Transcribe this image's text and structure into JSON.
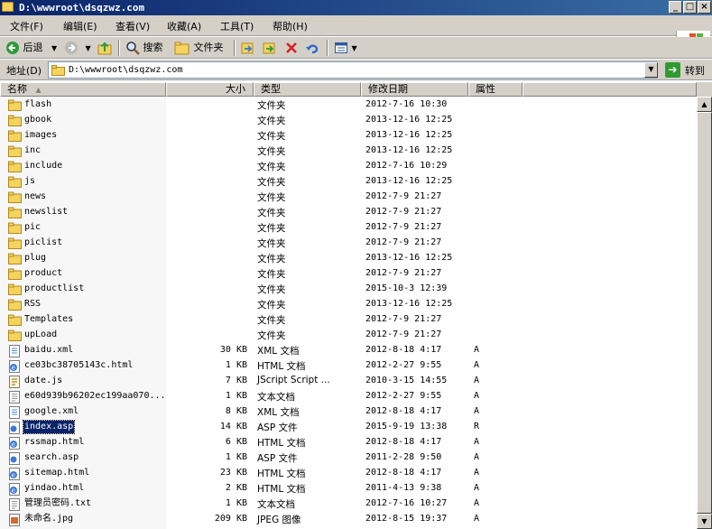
{
  "window": {
    "title": "D:\\wwwroot\\dsqzwz.com"
  },
  "menu": {
    "items": [
      "文件(F)",
      "编辑(E)",
      "查看(V)",
      "收藏(A)",
      "工具(T)",
      "帮助(H)"
    ]
  },
  "toolbar": {
    "back_label": "后退",
    "search_label": "搜索",
    "folders_label": "文件夹"
  },
  "address": {
    "label": "地址(D)",
    "value": "D:\\wwwroot\\dsqzwz.com",
    "go_label": "转到"
  },
  "columns": {
    "name": "名称",
    "size": "大小",
    "type": "类型",
    "modified": "修改日期",
    "attributes": "属性"
  },
  "files": [
    {
      "name": "flash",
      "size": "",
      "type": "文件夹",
      "modified": "2012-7-16 10:30",
      "attr": "",
      "icon": "folder-icon"
    },
    {
      "name": "gbook",
      "size": "",
      "type": "文件夹",
      "modified": "2013-12-16 12:25",
      "attr": "",
      "icon": "folder-icon"
    },
    {
      "name": "images",
      "size": "",
      "type": "文件夹",
      "modified": "2013-12-16 12:25",
      "attr": "",
      "icon": "folder-icon"
    },
    {
      "name": "inc",
      "size": "",
      "type": "文件夹",
      "modified": "2013-12-16 12:25",
      "attr": "",
      "icon": "folder-icon"
    },
    {
      "name": "include",
      "size": "",
      "type": "文件夹",
      "modified": "2012-7-16 10:29",
      "attr": "",
      "icon": "folder-icon"
    },
    {
      "name": "js",
      "size": "",
      "type": "文件夹",
      "modified": "2013-12-16 12:25",
      "attr": "",
      "icon": "folder-icon"
    },
    {
      "name": "news",
      "size": "",
      "type": "文件夹",
      "modified": "2012-7-9 21:27",
      "attr": "",
      "icon": "folder-icon"
    },
    {
      "name": "newslist",
      "size": "",
      "type": "文件夹",
      "modified": "2012-7-9 21:27",
      "attr": "",
      "icon": "folder-icon"
    },
    {
      "name": "pic",
      "size": "",
      "type": "文件夹",
      "modified": "2012-7-9 21:27",
      "attr": "",
      "icon": "folder-icon"
    },
    {
      "name": "piclist",
      "size": "",
      "type": "文件夹",
      "modified": "2012-7-9 21:27",
      "attr": "",
      "icon": "folder-icon"
    },
    {
      "name": "plug",
      "size": "",
      "type": "文件夹",
      "modified": "2013-12-16 12:25",
      "attr": "",
      "icon": "folder-icon"
    },
    {
      "name": "product",
      "size": "",
      "type": "文件夹",
      "modified": "2012-7-9 21:27",
      "attr": "",
      "icon": "folder-icon"
    },
    {
      "name": "productlist",
      "size": "",
      "type": "文件夹",
      "modified": "2015-10-3 12:39",
      "attr": "",
      "icon": "folder-icon"
    },
    {
      "name": "RSS",
      "size": "",
      "type": "文件夹",
      "modified": "2013-12-16 12:25",
      "attr": "",
      "icon": "folder-icon"
    },
    {
      "name": "Templates",
      "size": "",
      "type": "文件夹",
      "modified": "2012-7-9 21:27",
      "attr": "",
      "icon": "folder-icon"
    },
    {
      "name": "upLoad",
      "size": "",
      "type": "文件夹",
      "modified": "2012-7-9 21:27",
      "attr": "",
      "icon": "folder-icon"
    },
    {
      "name": "baidu.xml",
      "size": "30 KB",
      "type": "XML 文档",
      "modified": "2012-8-18 4:17",
      "attr": "A",
      "icon": "xml-file-icon"
    },
    {
      "name": "ce03bc38705143c.html",
      "size": "1 KB",
      "type": "HTML 文档",
      "modified": "2012-2-27 9:55",
      "attr": "A",
      "icon": "html-file-icon"
    },
    {
      "name": "date.js",
      "size": "7 KB",
      "type": "JScript Script ...",
      "modified": "2010-3-15 14:55",
      "attr": "A",
      "icon": "script-file-icon"
    },
    {
      "name": "e60d939b96202ec199aa070...",
      "size": "1 KB",
      "type": "文本文档",
      "modified": "2012-2-27 9:55",
      "attr": "A",
      "icon": "text-file-icon"
    },
    {
      "name": "google.xml",
      "size": "8 KB",
      "type": "XML 文档",
      "modified": "2012-8-18 4:17",
      "attr": "A",
      "icon": "xml-file-icon"
    },
    {
      "name": "index.asp",
      "size": "14 KB",
      "type": "ASP 文件",
      "modified": "2015-9-19 13:38",
      "attr": "R",
      "icon": "asp-file-icon",
      "selected": true
    },
    {
      "name": "rssmap.html",
      "size": "6 KB",
      "type": "HTML 文档",
      "modified": "2012-8-18 4:17",
      "attr": "A",
      "icon": "html-file-icon"
    },
    {
      "name": "search.asp",
      "size": "1 KB",
      "type": "ASP 文件",
      "modified": "2011-2-28 9:50",
      "attr": "A",
      "icon": "asp-file-icon"
    },
    {
      "name": "sitemap.html",
      "size": "23 KB",
      "type": "HTML 文档",
      "modified": "2012-8-18 4:17",
      "attr": "A",
      "icon": "html-file-icon"
    },
    {
      "name": "yindao.html",
      "size": "2 KB",
      "type": "HTML 文档",
      "modified": "2011-4-13 9:38",
      "attr": "A",
      "icon": "html-file-icon"
    },
    {
      "name": "管理员密码.txt",
      "size": "1 KB",
      "type": "文本文档",
      "modified": "2012-7-16 10:27",
      "attr": "A",
      "icon": "text-file-icon"
    },
    {
      "name": "未命名.jpg",
      "size": "209 KB",
      "type": "JPEG 图像",
      "modified": "2012-8-15 19:37",
      "attr": "A",
      "icon": "image-file-icon"
    }
  ],
  "colors": {
    "title_start": "#0a246a",
    "title_end": "#3a6ea5",
    "selection": "#0a246a",
    "chrome": "#d4d0c8",
    "folder": "#f4d35e"
  }
}
